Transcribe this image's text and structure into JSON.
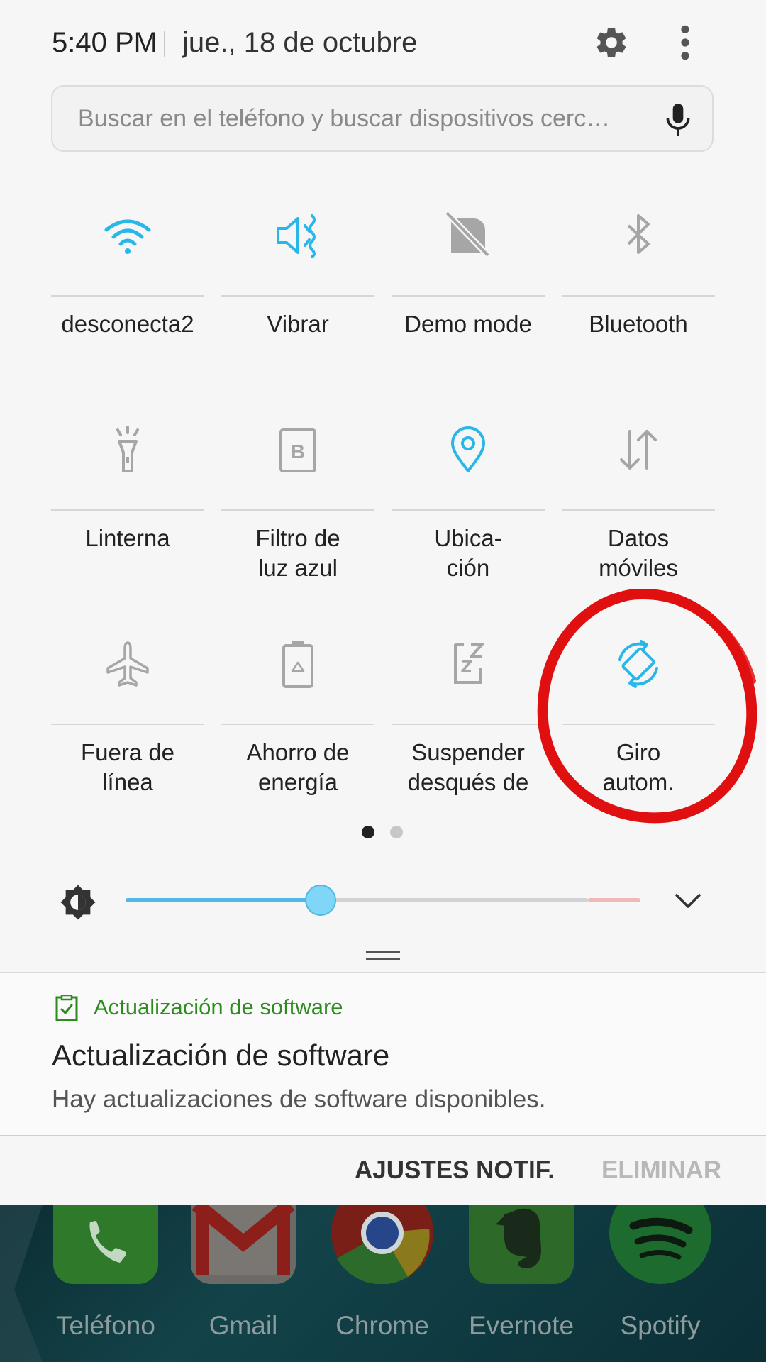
{
  "status": {
    "time": "5:40 PM",
    "date": "jue., 18 de octubre"
  },
  "search": {
    "placeholder": "Buscar en el teléfono y buscar dispositivos cerc…"
  },
  "tiles": [
    {
      "label": "desconecta2",
      "icon": "wifi-icon",
      "active": true
    },
    {
      "label": "Vibrar",
      "icon": "vibrate-icon",
      "active": true
    },
    {
      "label": "Demo mode",
      "icon": "demo-mode-icon",
      "active": false
    },
    {
      "label": "Bluetooth",
      "icon": "bluetooth-icon",
      "active": false
    },
    {
      "label": "Linterna",
      "icon": "flashlight-icon",
      "active": false
    },
    {
      "label": "Filtro de\nluz azul",
      "icon": "blue-light-filter-icon",
      "active": false
    },
    {
      "label": "Ubica-\nción",
      "icon": "location-icon",
      "active": true
    },
    {
      "label": "Datos\nmóviles",
      "icon": "mobile-data-icon",
      "active": false
    },
    {
      "label": "Fuera de\nlínea",
      "icon": "airplane-icon",
      "active": false
    },
    {
      "label": "Ahorro de\nenergía",
      "icon": "power-saving-icon",
      "active": false
    },
    {
      "label": "Suspender\ndesqués de",
      "icon": "sleep-icon",
      "active": false
    },
    {
      "label": "Giro\nautom.",
      "icon": "auto-rotate-icon",
      "active": true
    }
  ],
  "pager": {
    "pages": 2,
    "current": 1
  },
  "brightness": {
    "level": 0.38
  },
  "notification": {
    "app": "Actualización de software",
    "title": "Actualización de software",
    "body": "Hay actualizaciones de software disponibles.",
    "action_settings": "AJUSTES NOTIF.",
    "action_clear": "ELIMINAR"
  },
  "dock": [
    {
      "name": "Teléfono",
      "icon": "phone-app-icon"
    },
    {
      "name": "Gmail",
      "icon": "gmail-app-icon"
    },
    {
      "name": "Chrome",
      "icon": "chrome-app-icon"
    },
    {
      "name": "Evernote",
      "icon": "evernote-app-icon"
    },
    {
      "name": "Spotify",
      "icon": "spotify-app-icon"
    }
  ],
  "colors": {
    "accent": "#29b6e8",
    "inactive_icon": "#9e9e9e",
    "notification_app": "#2e8b1f",
    "annotation": "#e01010"
  }
}
